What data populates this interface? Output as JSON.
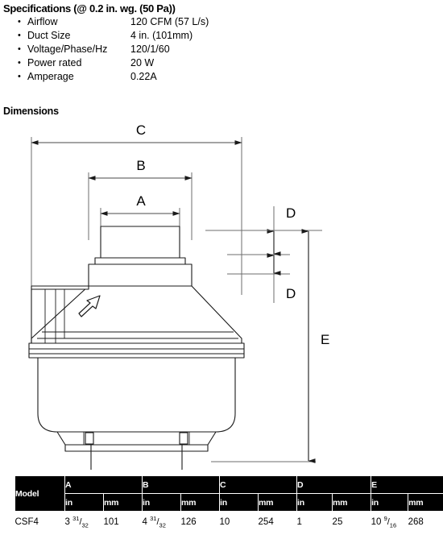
{
  "specifications": {
    "title": "Specifications (@ 0.2 in. wg. (50 Pa))",
    "bullet": "•",
    "rows": [
      {
        "label": "Airflow",
        "value": "120 CFM (57 L/s)"
      },
      {
        "label": "Duct Size",
        "value": "4 in. (101mm)"
      },
      {
        "label": "Voltage/Phase/Hz",
        "value": "120/1/60"
      },
      {
        "label": "Power rated",
        "value": "20 W"
      },
      {
        "label": "Amperage",
        "value": "0.22A"
      }
    ]
  },
  "dimensions": {
    "title": "Dimensions",
    "labels": {
      "a": "A",
      "b": "B",
      "c": "C",
      "d_upper": "D",
      "d_lower": "D",
      "e": "E"
    }
  },
  "table": {
    "model_header": "Model",
    "groups": [
      "A",
      "B",
      "C",
      "D",
      "E"
    ],
    "unit_headers": [
      "in",
      "mm",
      "in",
      "mm",
      "in",
      "mm",
      "in",
      "mm",
      "in",
      "mm"
    ],
    "rows": [
      {
        "model": "CSF4",
        "a_in_whole": "3",
        "a_in_num": "31",
        "a_in_den": "32",
        "a_mm": "101",
        "b_in_whole": "4",
        "b_in_num": "31",
        "b_in_den": "32",
        "b_mm": "126",
        "c_in": "10",
        "c_mm": "254",
        "d_in": "1",
        "d_mm": "25",
        "e_in_whole": "10",
        "e_in_num": "9",
        "e_in_den": "16",
        "e_mm": "268"
      }
    ]
  }
}
